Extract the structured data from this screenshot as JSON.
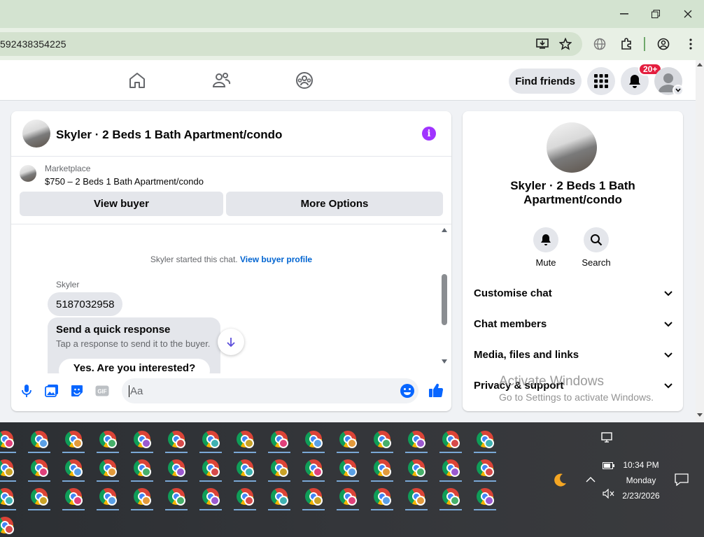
{
  "browser": {
    "url": "592438354225",
    "window_controls": [
      "minimize",
      "maximize",
      "close"
    ]
  },
  "facebook": {
    "find_friends_label": "Find friends",
    "notification_badge": "20+"
  },
  "chat": {
    "title": "Skyler · 2 Beds 1 Bath Apartment/condo",
    "marketplace_label": "Marketplace",
    "listing": "$750 – 2 Beds 1 Bath Apartment/condo",
    "view_buyer_label": "View buyer",
    "more_options_label": "More Options",
    "started_text": "Skyler started this chat.",
    "view_buyer_profile": "View buyer profile",
    "sender_name": "Skyler",
    "message": "5187032958",
    "quick_response_title": "Send a quick response",
    "quick_response_subtitle": "Tap a response to send it to the buyer.",
    "quick_response_option": "Yes. Are you interested?",
    "composer_placeholder": "Aa"
  },
  "side_panel": {
    "title": "Skyler · 2 Beds 1 Bath Apartment/condo",
    "actions": [
      {
        "label": "Mute",
        "icon": "bell-icon"
      },
      {
        "label": "Search",
        "icon": "search-icon"
      }
    ],
    "rows": [
      "Customise chat",
      "Chat members",
      "Media, files and links",
      "Privacy & support"
    ]
  },
  "watermark": {
    "line1": "Activate Windows",
    "line2": "Go to Settings to activate Windows."
  },
  "taskbar": {
    "time": "10:34 PM",
    "day": "Monday",
    "date": "2/23/2026"
  },
  "colors": {
    "accent": "#0064d1",
    "info": "#a033ff",
    "badge": "#e41e3f",
    "like": "#0866ff"
  }
}
